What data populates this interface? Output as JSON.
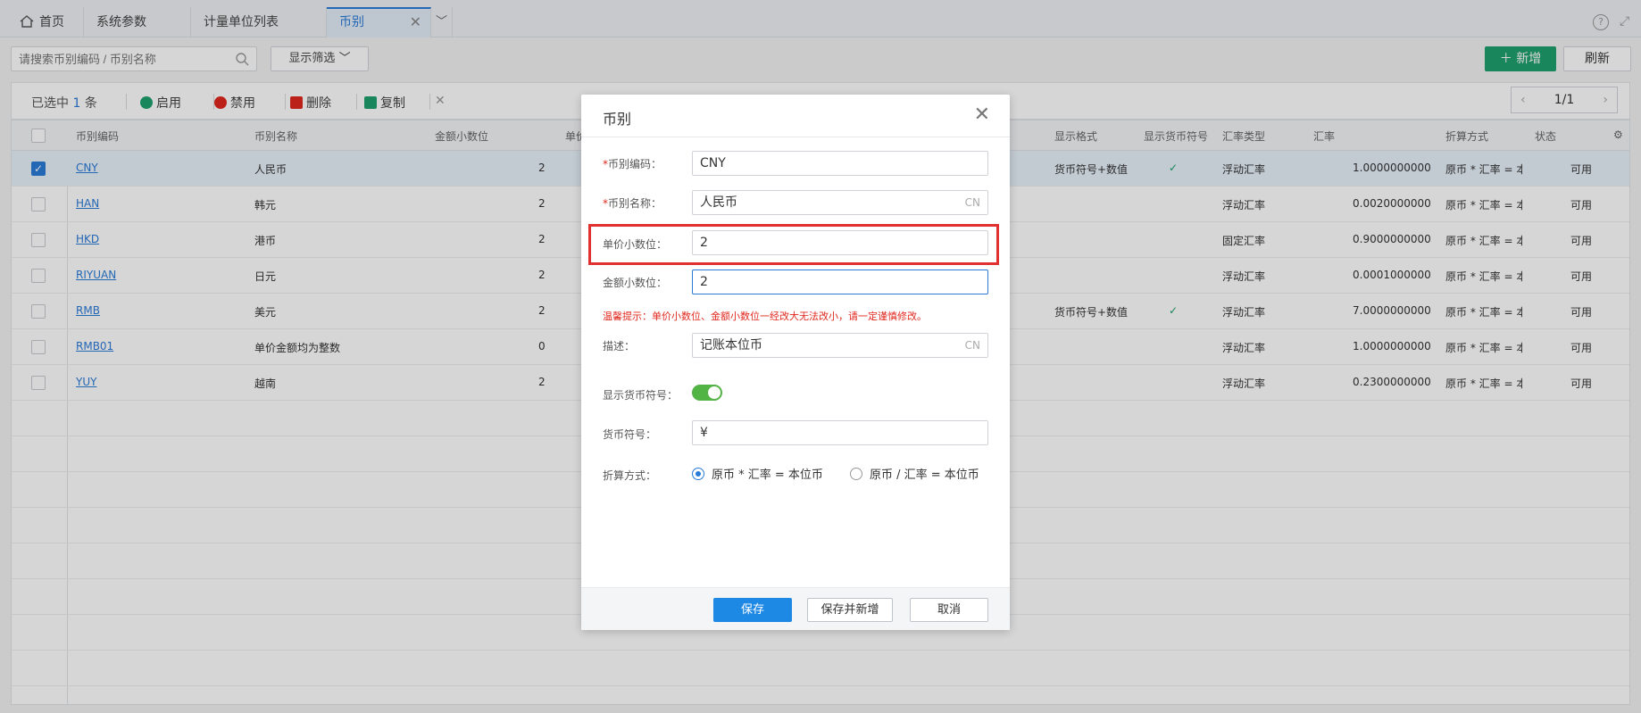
{
  "tabs": [
    {
      "label": "首页",
      "icon": "home-icon"
    },
    {
      "label": "系统参数"
    },
    {
      "label": "计量单位列表"
    },
    {
      "label": "币别",
      "active": true
    }
  ],
  "toolbar": {
    "search_placeholder": "请搜索币别编码 / 币别名称",
    "filter_label": "显示筛选",
    "add_label": "新增",
    "refresh_label": "刷新"
  },
  "actions": {
    "selected_prefix": "已选中",
    "selected_count": "1",
    "selected_suffix": "条",
    "enable": "启用",
    "disable": "禁用",
    "delete": "删除",
    "copy": "复制",
    "page": "1/1"
  },
  "columns": [
    "币别编码",
    "币别名称",
    "金额小数位",
    "单价",
    "显示格式",
    "显示货币符号",
    "汇率类型",
    "汇率",
    "折算方式",
    "状态"
  ],
  "rows": [
    {
      "code": "CNY",
      "name": "人民币",
      "amount_digits": "2",
      "format": "货币符号+数值",
      "show_symbol": true,
      "rate_type": "浮动汇率",
      "rate": "1.0000000000",
      "method": "原币 * 汇率 = 本位币",
      "status": "可用",
      "checked": true
    },
    {
      "code": "HAN",
      "name": "韩元",
      "amount_digits": "2",
      "format": "",
      "show_symbol": false,
      "rate_type": "浮动汇率",
      "rate": "0.0020000000",
      "method": "原币 * 汇率 = 本位币",
      "status": "可用"
    },
    {
      "code": "HKD",
      "name": "港币",
      "amount_digits": "2",
      "format": "",
      "show_symbol": false,
      "rate_type": "固定汇率",
      "rate": "0.9000000000",
      "method": "原币 * 汇率 = 本位币",
      "status": "可用"
    },
    {
      "code": "RIYUAN",
      "name": "日元",
      "amount_digits": "2",
      "format": "",
      "show_symbol": false,
      "rate_type": "浮动汇率",
      "rate": "0.0001000000",
      "method": "原币 * 汇率 = 本位币",
      "status": "可用"
    },
    {
      "code": "RMB",
      "name": "美元",
      "amount_digits": "2",
      "format": "货币符号+数值",
      "show_symbol": true,
      "rate_type": "浮动汇率",
      "rate": "7.0000000000",
      "method": "原币 * 汇率 = 本位币",
      "status": "可用"
    },
    {
      "code": "RMB01",
      "name": "单价金额均为整数",
      "amount_digits": "0",
      "format": "",
      "show_symbol": false,
      "rate_type": "浮动汇率",
      "rate": "1.0000000000",
      "method": "原币 * 汇率 = 本位币",
      "status": "可用"
    },
    {
      "code": "YUY",
      "name": "越南",
      "amount_digits": "2",
      "format": "",
      "show_symbol": false,
      "rate_type": "浮动汇率",
      "rate": "0.2300000000",
      "method": "原币 * 汇率 = 本位币",
      "status": "可用"
    }
  ],
  "modal": {
    "title": "币别",
    "fields": {
      "code_label": "币别编码：",
      "code_value": "CNY",
      "name_label": "币别名称：",
      "name_value": "人民币",
      "name_suffix": "CN",
      "price_digits_label": "单价小数位：",
      "price_digits_value": "2",
      "amount_digits_label": "金额小数位：",
      "amount_digits_value": "2",
      "warning": "温馨提示：单价小数位、金额小数位一经改大无法改小，请一定谨慎修改。",
      "desc_label": "描述：",
      "desc_value": "记账本位币",
      "desc_suffix": "CN",
      "show_symbol_label": "显示货币符号：",
      "symbol_label": "货币符号：",
      "symbol_value": "¥",
      "method_label": "折算方式：",
      "method_option1": "原币 * 汇率 = 本位币",
      "method_option2": "原币 / 汇率 = 本位币"
    },
    "buttons": {
      "save": "保存",
      "save_and_new": "保存并新增",
      "cancel": "取消"
    }
  },
  "colors": {
    "accent": "#2a7bd8",
    "add_green": "#1fa06d",
    "toggle_green": "#52b444",
    "highlight_red": "#e03030"
  }
}
